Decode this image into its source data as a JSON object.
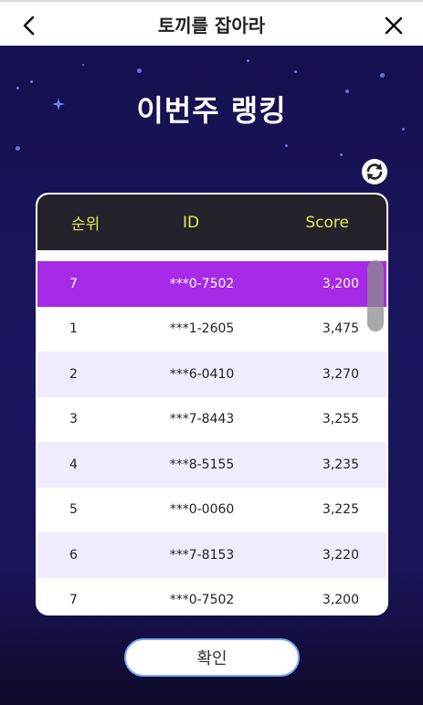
{
  "header": {
    "title": "토끼를 잡아라",
    "back_icon": "chevron-left-icon",
    "close_icon": "close-icon"
  },
  "page": {
    "title": "이번주 랭킹",
    "refresh_icon": "refresh-icon"
  },
  "table": {
    "columns": [
      "순위",
      "ID",
      "Score"
    ],
    "my_row": {
      "rank": "7",
      "id": "***0-7502",
      "score": "3,200"
    },
    "rows": [
      {
        "rank": "1",
        "id": "***1-2605",
        "score": "3,475"
      },
      {
        "rank": "2",
        "id": "***6-0410",
        "score": "3,270"
      },
      {
        "rank": "3",
        "id": "***7-8443",
        "score": "3,255"
      },
      {
        "rank": "4",
        "id": "***8-5155",
        "score": "3,235"
      },
      {
        "rank": "5",
        "id": "***0-0060",
        "score": "3,225"
      },
      {
        "rank": "6",
        "id": "***7-8153",
        "score": "3,220"
      },
      {
        "rank": "7",
        "id": "***0-7502",
        "score": "3,200"
      }
    ]
  },
  "confirm_label": "확인",
  "colors": {
    "highlight": "#a72be6",
    "header_text": "#e3e85a",
    "table_head_bg": "#25222c",
    "alt_row": "#efecfd",
    "background": "#1a1450"
  }
}
